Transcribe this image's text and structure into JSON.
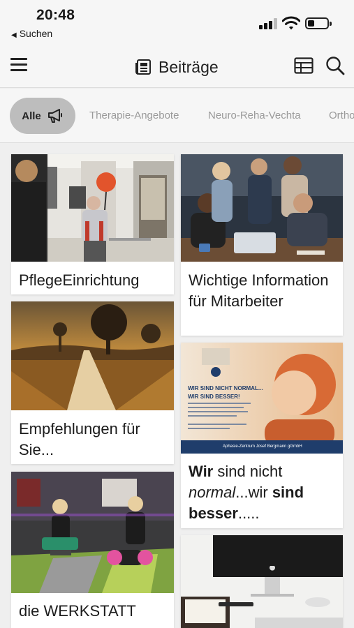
{
  "status_bar": {
    "time": "20:48",
    "back_label": "Suchen"
  },
  "nav": {
    "title": "Beiträge",
    "menu_icon": "hamburger-icon",
    "title_icon": "newspaper-icon",
    "table_icon": "table-icon",
    "search_icon": "search-icon"
  },
  "tabs": [
    {
      "label": "Alle",
      "selected": true,
      "icon": "megaphone-icon"
    },
    {
      "label": "Therapie-Angebote",
      "selected": false
    },
    {
      "label": "Neuro-Reha-Vechta",
      "selected": false
    },
    {
      "label": "Ortho",
      "selected": false
    }
  ],
  "cards": {
    "c1": {
      "title": "PflegeEinrichtung"
    },
    "c2": {
      "title": "Wichtige Information für Mitarbeiter"
    },
    "c3": {
      "title": "Empfehlungen für Sie..."
    },
    "c4": {
      "title_parts": {
        "p1": "Wir",
        "p2": " sind nicht ",
        "p3": "normal",
        "p4": "...wir ",
        "p5": "sind",
        "p6": "besser",
        "p7": "....."
      },
      "flyer": {
        "headline": "WIR SIND NICHT NORMAL... WIR SIND BESSER!",
        "footer_name": "Aphasie-Zentrum Josef Bergmann gGmbH"
      }
    },
    "c5": {
      "title": "die WERKSTATT"
    }
  },
  "colors": {
    "accent_chip": "#bdbdbd",
    "tab_inactive": "#9a9a9a",
    "background": "#efefef"
  }
}
